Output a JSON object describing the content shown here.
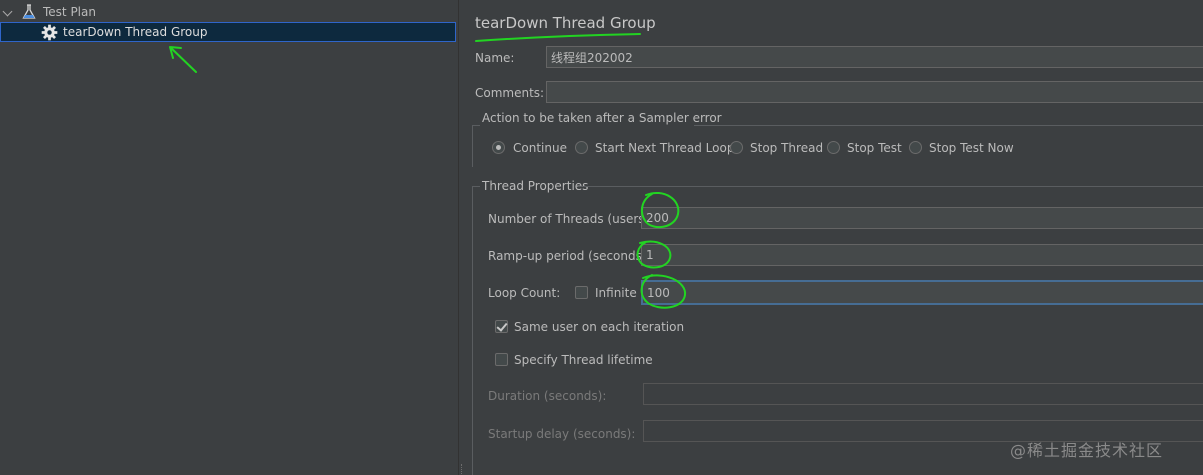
{
  "tree": {
    "root_label": "Test Plan",
    "child_label": "tearDown Thread Group"
  },
  "form": {
    "title": "tearDown Thread Group",
    "name_label": "Name:",
    "name_value": "线程组202002",
    "comments_label": "Comments:",
    "comments_value": "",
    "sampler_error": {
      "heading": "Action to be taken after a Sampler error",
      "options": [
        "Continue",
        "Start Next Thread Loop",
        "Stop Thread",
        "Stop Test",
        "Stop Test Now"
      ],
      "selected": "Continue"
    },
    "thread_properties": {
      "heading": "Thread Properties",
      "threads_label": "Number of Threads (users):",
      "threads_value": "200",
      "rampup_label": "Ramp-up period (seconds):",
      "rampup_value": "1",
      "loop_label": "Loop Count:",
      "infinite_label": "Infinite",
      "infinite_checked": false,
      "loop_value": "100",
      "same_user_label": "Same user on each iteration",
      "same_user_checked": true,
      "lifetime_label": "Specify Thread lifetime",
      "lifetime_checked": false,
      "duration_label": "Duration (seconds):",
      "duration_value": "",
      "startup_label": "Startup delay (seconds):",
      "startup_value": ""
    }
  },
  "watermark": "@稀土掘金技术社区",
  "colors": {
    "background": "#3c3f41",
    "selection": "#0d293e",
    "annotation": "#22d422",
    "focus_border": "#466d94"
  },
  "icons": [
    "expand-arrow-icon",
    "test-plan-flask-icon",
    "gear-icon"
  ]
}
